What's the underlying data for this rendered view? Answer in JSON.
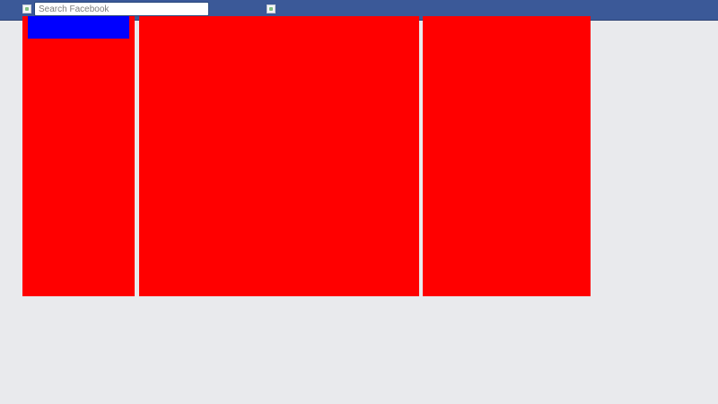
{
  "header": {
    "search": {
      "placeholder": "Search Facebook",
      "value": ""
    },
    "logo_icon": "broken-image-icon",
    "center_icon": "broken-image-icon"
  },
  "colors": {
    "topbar": "#3b5998",
    "page_background": "#e9eaed",
    "column_fill": "#ff0000",
    "left_block_fill": "#0000ff"
  }
}
